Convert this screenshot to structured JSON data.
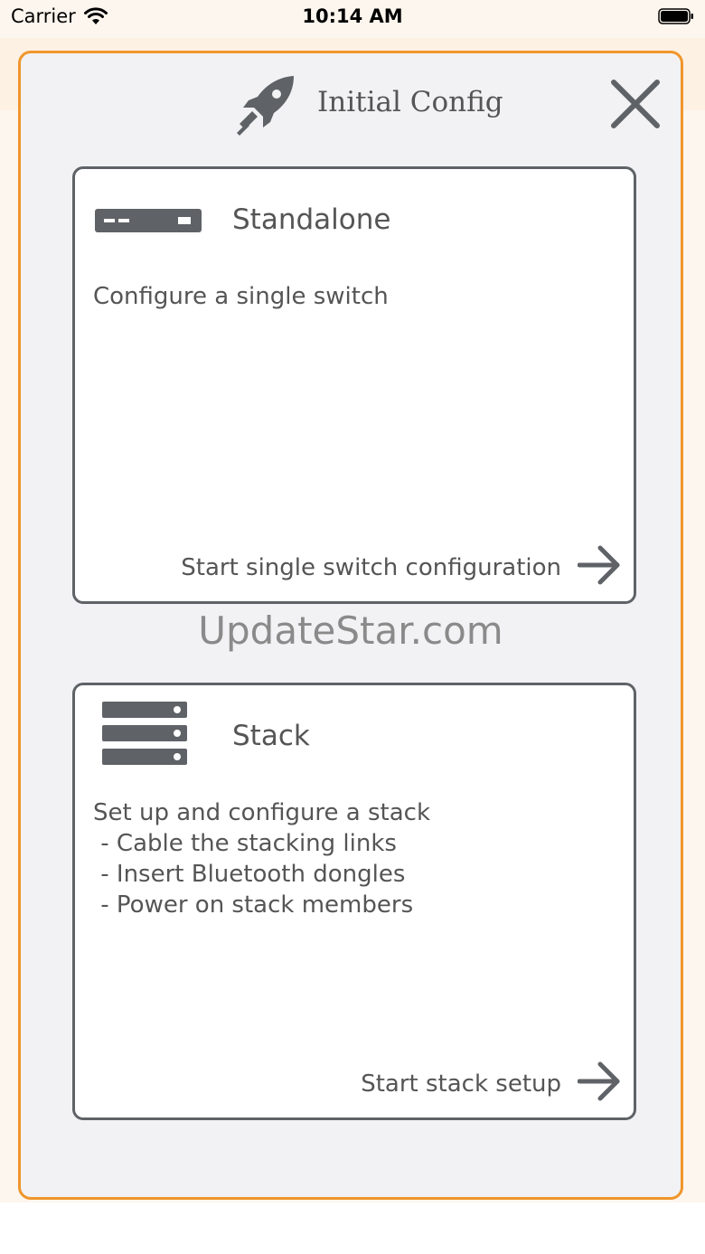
{
  "status": {
    "carrier": "Carrier",
    "time": "10:14 AM"
  },
  "header": {
    "title": "Initial Config"
  },
  "standalone": {
    "title": "Standalone",
    "description": "Configure a single switch",
    "action": "Start single switch configuration"
  },
  "watermark": "UpdateStar.com",
  "stack": {
    "title": "Stack",
    "description_lines": [
      "Set up and configure a stack",
      " - Cable the stacking links",
      " - Insert Bluetooth dongles",
      " - Power on stack members"
    ],
    "action": "Start stack setup"
  },
  "colors": {
    "accent": "#f0962c",
    "icon": "#5f6266",
    "text": "#555555"
  }
}
